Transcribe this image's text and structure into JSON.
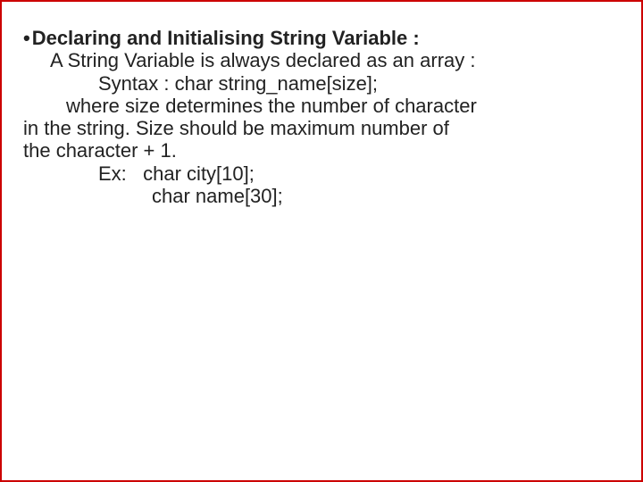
{
  "heading": "Declaring and Initialising String Variable :",
  "body": {
    "l1": "A String Variable is always declared as an array :",
    "l2": "Syntax : char string_name[size];",
    "l3": "where size determines the number of character",
    "l4": "in the string. Size should be maximum number of",
    "l5": "the character + 1.",
    "l6_label": "Ex:",
    "l6_code": "char city[10];",
    "l7_code": "char name[30];"
  }
}
